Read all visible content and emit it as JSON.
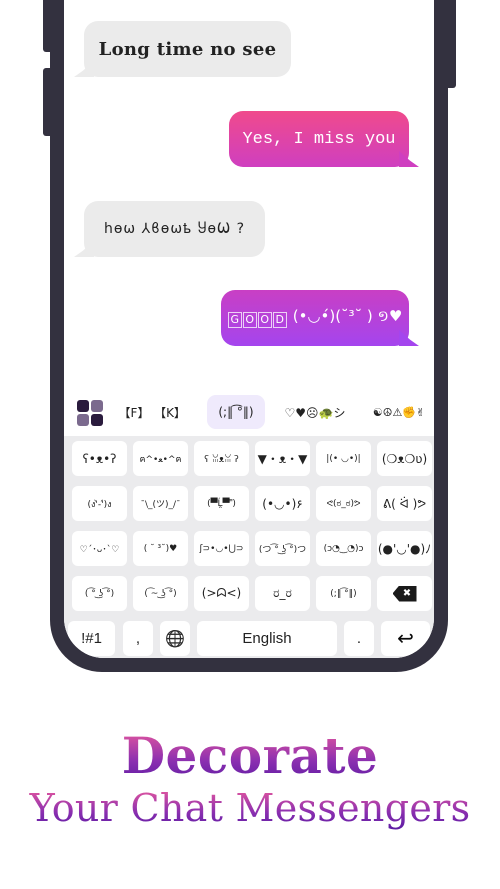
{
  "chat": {
    "messages": [
      {
        "direction": "incoming",
        "text": "Long time no see"
      },
      {
        "direction": "outgoing",
        "text": "Yes, I miss you"
      },
      {
        "direction": "incoming",
        "text": "hѳѡ ⅄ϐѳѡҍ ႸѳѠ ?"
      },
      {
        "direction": "outgoing",
        "boxed_letters": [
          "G",
          "O",
          "O",
          "D"
        ],
        "text": "(•◡•́)(˘³˘ ) ១♥"
      }
    ],
    "colors": {
      "incoming_bg": "#ebebeb",
      "outgoing_gradient_1": [
        "#f04a8c",
        "#cf3fc0"
      ],
      "outgoing_gradient_2": [
        "#c93fc4",
        "#a445ee"
      ]
    }
  },
  "keyboard": {
    "categories": [
      {
        "label": "【F】",
        "active": false
      },
      {
        "label": "【K】",
        "active": false
      },
      {
        "label": "(;‖ ͡°‖)",
        "active": true
      },
      {
        "label": "♡♥☹🐢シ",
        "active": false
      },
      {
        "label": "☯☮⚠✊✌",
        "active": false
      }
    ],
    "kaomoji_rows": [
      [
        "ʕ•ᴥ•ʔ",
        "ฅ^•ﻌ•^ฅ",
        "ʕ ꈍᴥꈍ ʔ",
        "▼・ᴥ・▼",
        "|(• ◡•)|",
        "(❍ᴥ❍ʋ)"
      ],
      [
        "(ง'̀-'́)ง",
        "¯\\_(ツ)_/¯",
        "(▀̿Ĺ̯▀̿ ̿)",
        "(•◡•)۶",
        "ᕙ(ಠ_ಠ)ᕗ",
        "ᕕ( ᐛ )ᕗ"
      ],
      [
        "♡´･ᴗ･`♡",
        "( ˘ ³˘)♥",
        "ʃ⊃•◡•⋃⊃",
        "(つ ͡° ͜ʖ ͡°)つ",
        "(ɔ◔‿◔)ɔ",
        "(●'◡'●)ﾉ"
      ],
      [
        "( ͡° ͜ʖ ͡°)",
        "( ͡~ ͜ʖ ͡°)",
        "(>ᗣ<)",
        "ರ_ರ",
        "(;‖ ͡°‖)",
        "backspace"
      ]
    ],
    "bottom_row": {
      "symbols_label": "!#1",
      "comma_label": ",",
      "globe_icon": "globe-icon",
      "space_label": "English",
      "period_label": ".",
      "enter_icon": "enter-icon"
    },
    "icons": {
      "backspace": "✖",
      "enter": "↩",
      "globe": "🌐"
    }
  },
  "tagline": {
    "headline": "Decorate",
    "subheadline": "Your Chat Messengers"
  }
}
